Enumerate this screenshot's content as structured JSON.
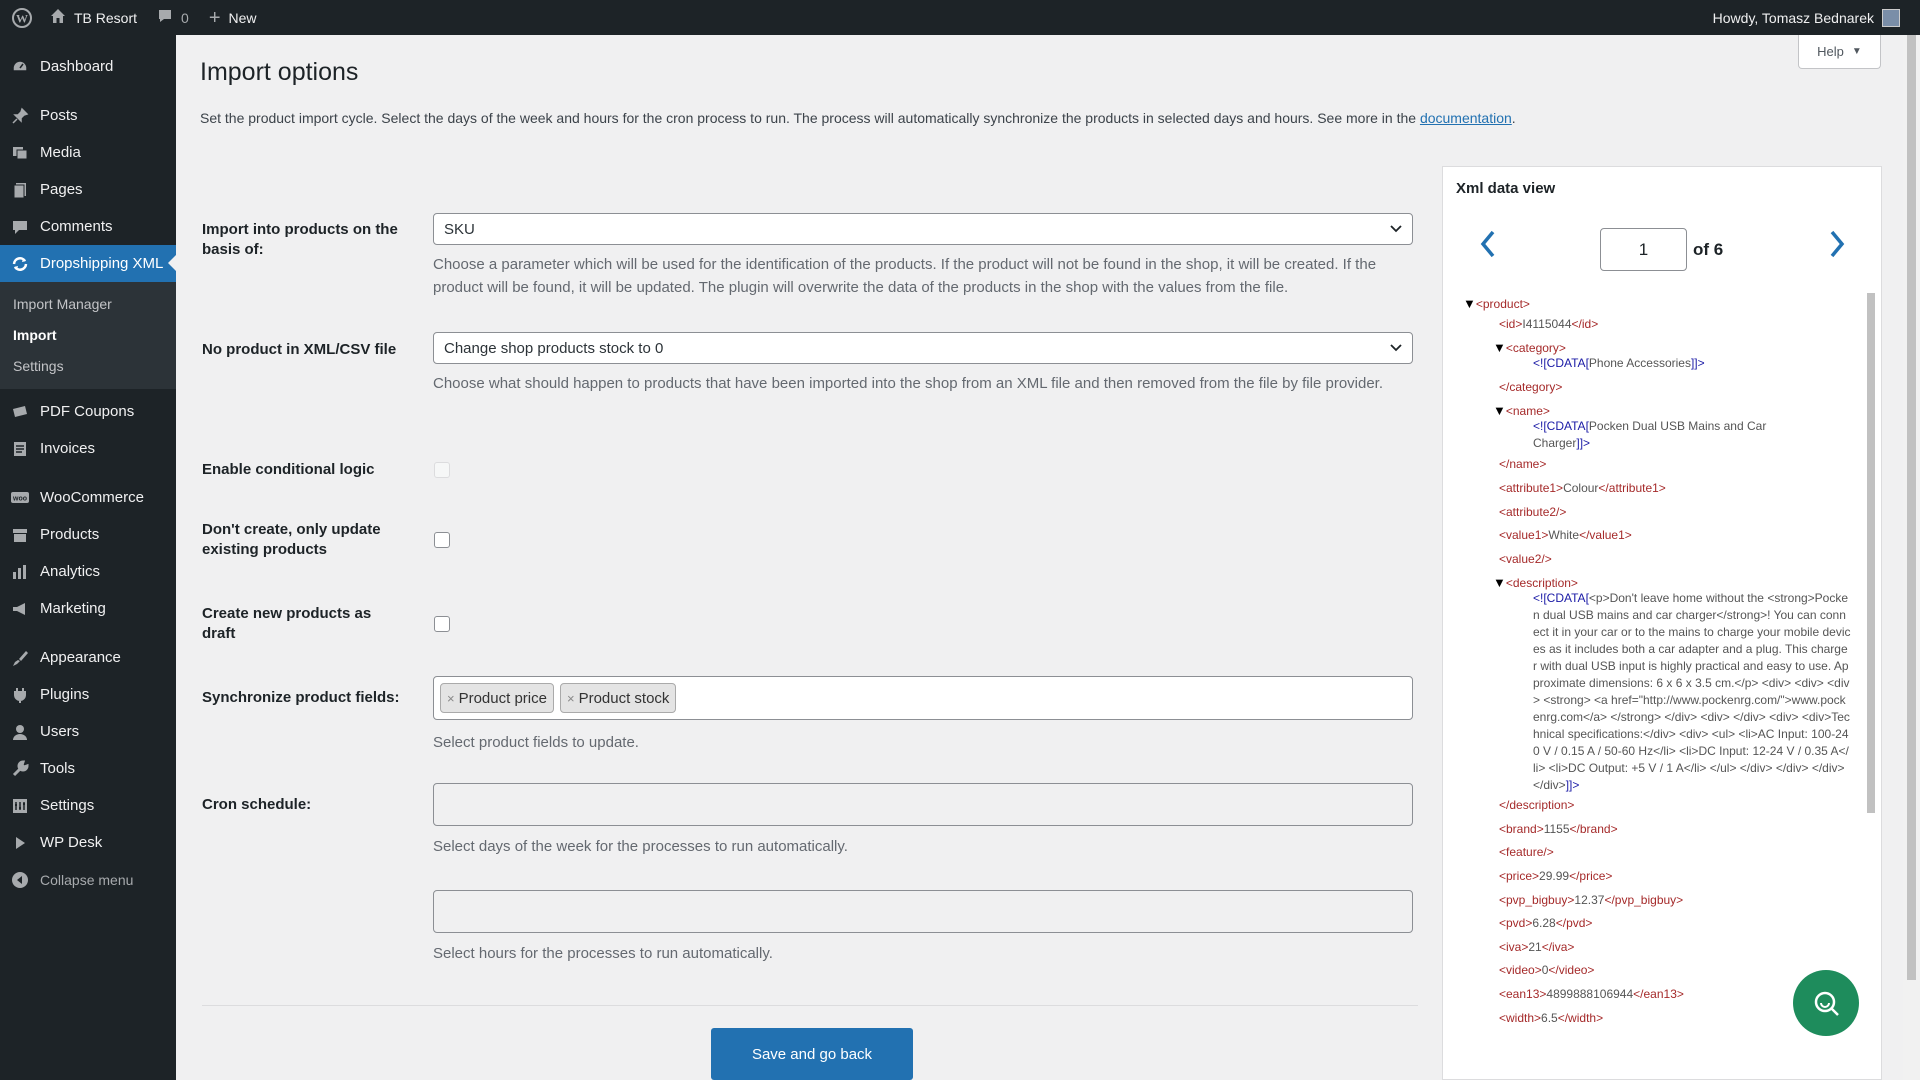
{
  "adminbar": {
    "site_name": "TB Resort",
    "comments_count": "0",
    "new_label": "New",
    "howdy": "Howdy, Tomasz Bednarek"
  },
  "sidebar": {
    "items": [
      {
        "label": "Dashboard",
        "icon": "dashboard-icon"
      },
      {
        "label": "Posts",
        "icon": "pin-icon"
      },
      {
        "label": "Media",
        "icon": "media-icon"
      },
      {
        "label": "Pages",
        "icon": "pages-icon"
      },
      {
        "label": "Comments",
        "icon": "comment-icon"
      },
      {
        "label": "Dropshipping XML",
        "icon": "sync-icon"
      }
    ],
    "submenu": [
      "Import Manager",
      "Import",
      "Settings"
    ],
    "items2": [
      {
        "label": "PDF Coupons",
        "icon": "coupon-icon"
      },
      {
        "label": "Invoices",
        "icon": "invoice-icon"
      },
      {
        "label": "WooCommerce",
        "icon": "woo-icon"
      },
      {
        "label": "Products",
        "icon": "archive-icon"
      },
      {
        "label": "Analytics",
        "icon": "bar-chart-icon"
      },
      {
        "label": "Marketing",
        "icon": "megaphone-icon"
      },
      {
        "label": "Appearance",
        "icon": "brush-icon"
      },
      {
        "label": "Plugins",
        "icon": "plug-icon"
      },
      {
        "label": "Users",
        "icon": "user-icon"
      },
      {
        "label": "Tools",
        "icon": "wrench-icon"
      },
      {
        "label": "Settings",
        "icon": "settings-icon"
      },
      {
        "label": "WP Desk",
        "icon": "play-icon"
      }
    ],
    "collapse_label": "Collapse menu"
  },
  "header": {
    "help_label": "Help",
    "title": "Import options",
    "intro": "Set the product import cycle. Select the days of the week and hours for the cron process to run. The process will automatically synchronize the products in selected days and hours. See more in the ",
    "intro_link": "documentation",
    "intro_end": "."
  },
  "form": {
    "basis_label": "Import into products on the basis of:",
    "basis_value": "SKU",
    "basis_desc": "Choose a parameter which will be used for the identification of the products. If the product will not be found in the shop, it will be created. If the product will be found, it will be updated. The plugin will overwrite the data of the products in the shop with the values from the file.",
    "noproduct_label": "No product in XML/CSV file",
    "noproduct_value": "Change shop products stock to 0",
    "noproduct_desc": "Choose what should happen to products that have been imported into the shop from an XML file and then removed from the file by file provider.",
    "conditional_label": "Enable conditional logic",
    "update_only_label": "Don't create, only update existing products",
    "draft_label": "Create new products as draft",
    "sync_label": "Synchronize product fields:",
    "sync_tags": [
      "Product price",
      "Product stock"
    ],
    "sync_desc": "Select product fields to update.",
    "cron_label": "Cron schedule:",
    "cron_days_desc": "Select days of the week for the processes to run automatically.",
    "cron_hours_desc": "Select hours for the processes to run automatically.",
    "save_label": "Save and go back"
  },
  "xml_panel": {
    "title": "Xml data view",
    "page": "1",
    "of_label": "of 6",
    "lines": [
      {
        "tri": "▼",
        "t1": "<product>"
      },
      {
        "t1": "<id>",
        "txt": "I4115044",
        "t2": "</id>"
      },
      {
        "tri": "▼",
        "t1": "<category>"
      },
      {
        "c1": "<![CDATA[",
        "txt": "Phone Accessories",
        "c2": "]]>"
      },
      {
        "t1": "</category>"
      },
      {
        "tri": "▼",
        "t1": "<name>"
      },
      {
        "c1": "<![CDATA[",
        "txt": "Pocken Dual USB Mains and Car Charger",
        "c2": "]]>"
      },
      {
        "t1": "</name>"
      },
      {
        "t1": "<attribute1>",
        "txt": "Colour",
        "t2": "</attribute1>"
      },
      {
        "t1": "<attribute2/>"
      },
      {
        "t1": "<value1>",
        "txt": "White",
        "t2": "</value1>"
      },
      {
        "t1": "<value2/>"
      },
      {
        "tri": "▼",
        "t1": "<description>"
      },
      {
        "c1": "<![CDATA[",
        "txt": "<p>Don't leave home without the <strong>Pocken dual USB mains and car charger</strong>! You can connect it in your car or to the mains to charge your mobile devices as it includes both a car adapter and a plug. This charger with dual USB input is highly practical and easy to use. Approximate dimensions: 6 x 6 x 3.5 cm.</p> <div> <div> <div> <strong> <a href=\"http://www.pockenrg.com/\">www.pockenrg.com</a> </strong> </div> <div>  </div> <div> <div>Technical specifications:</div> <div> <ul> <li>AC Input: 100-240 V / 0.15 A / 50-60 Hz</li> <li>DC Input: 12-24 V / 0.35 A</li> <li>DC Output: +5 V / 1 A</li> </ul> </div> </div> </div> </div>",
        "c2": "]]>"
      },
      {
        "t1": "</description>"
      },
      {
        "t1": "<brand>",
        "txt": "1155",
        "t2": "</brand>"
      },
      {
        "t1": "<feature/>"
      },
      {
        "t1": "<price>",
        "txt": "29.99",
        "t2": "</price>"
      },
      {
        "t1": "<pvp_bigbuy>",
        "txt": "12.37",
        "t2": "</pvp_bigbuy>"
      },
      {
        "t1": "<pvd>",
        "txt": "6.28",
        "t2": "</pvd>"
      },
      {
        "t1": "<iva>",
        "txt": "21",
        "t2": "</iva>"
      },
      {
        "t1": "<video>",
        "txt": "0",
        "t2": "</video>"
      },
      {
        "t1": "<ean13>",
        "txt": "4899888106944",
        "t2": "</ean13>"
      },
      {
        "t1": "<width>",
        "txt": "6.5",
        "t2": "</width>"
      }
    ]
  },
  "colors": {
    "accent": "#2271b1",
    "sidebar_bg": "#1d2327",
    "chat_button": "#1e8c5c"
  }
}
